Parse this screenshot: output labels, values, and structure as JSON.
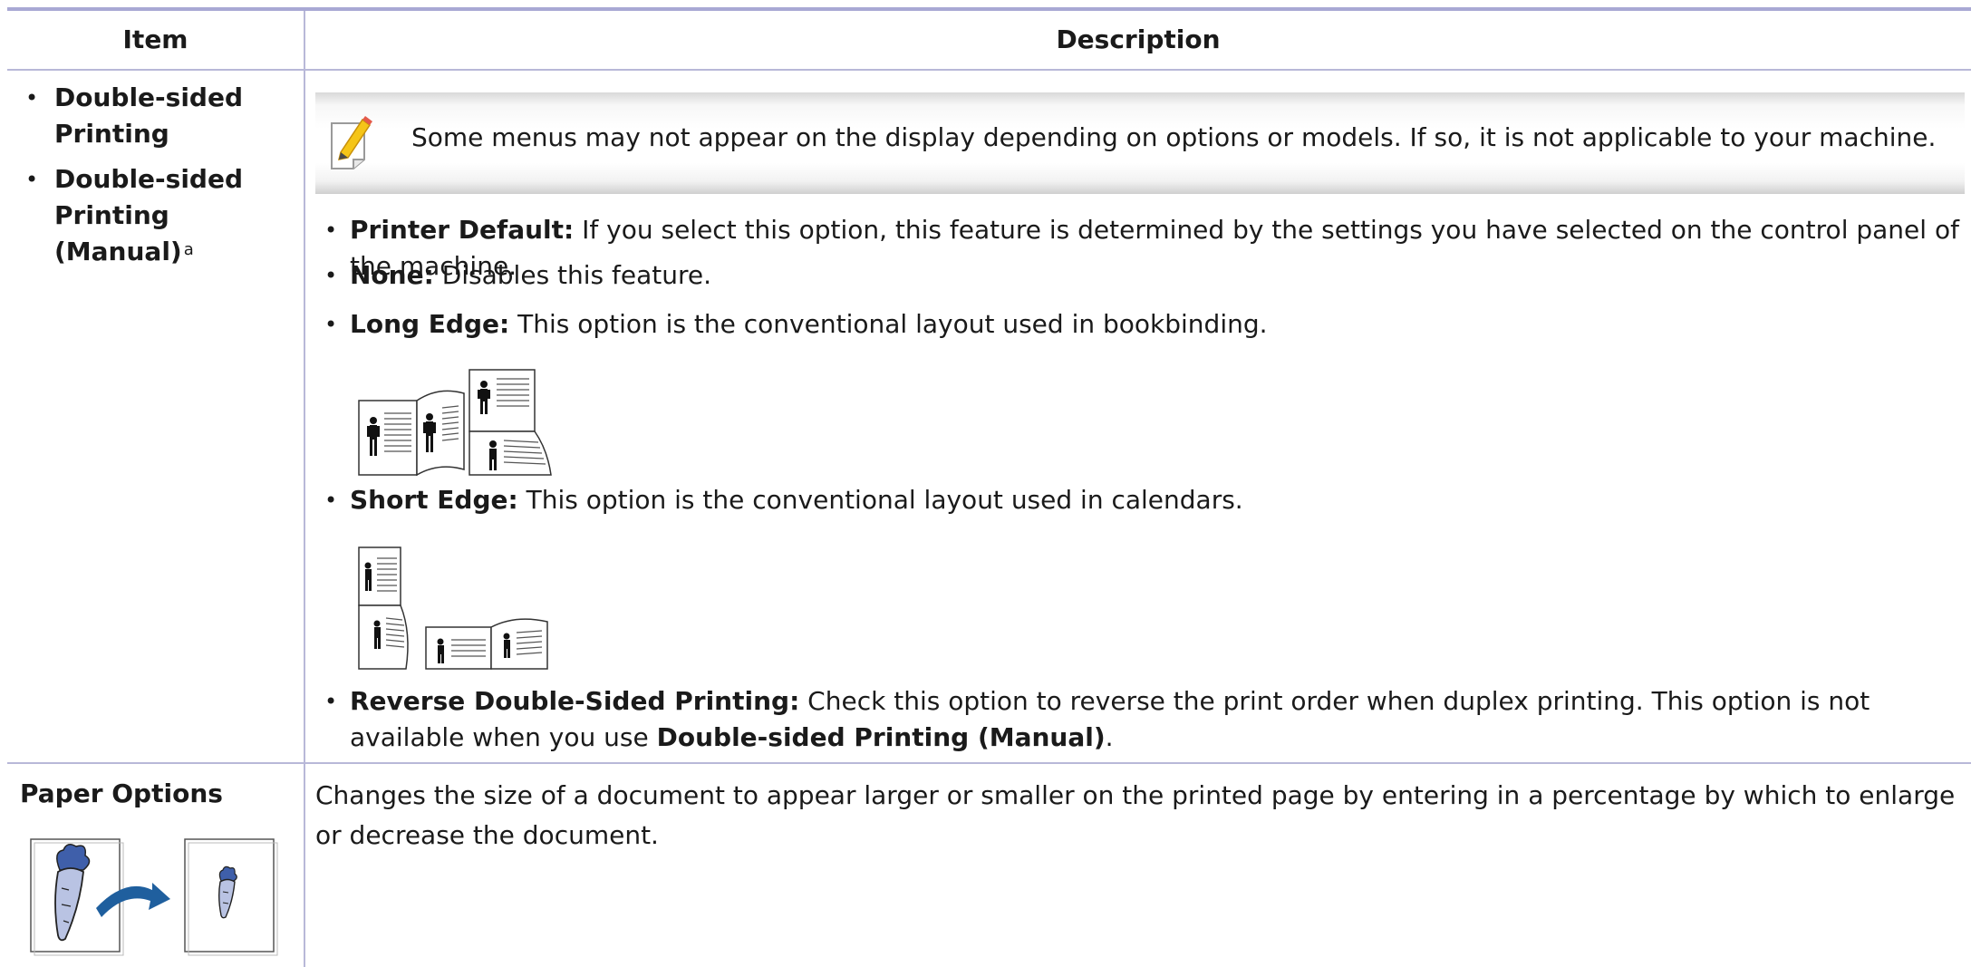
{
  "header": {
    "item": "Item",
    "description": "Description"
  },
  "row1": {
    "items": [
      {
        "label": "Double-sided Printing",
        "sup": ""
      },
      {
        "label": "Double-sided Printing (Manual)",
        "sup": "a"
      }
    ],
    "note": {
      "icon": "note-pencil-icon",
      "text": "Some menus may not appear on the display depending on options or models. If so, it is not applicable to your machine."
    },
    "options": [
      {
        "term": "Printer Default:",
        "text": " If you select this option, this feature is determined by the settings you have selected on the control panel of the machine."
      },
      {
        "term": "None:",
        "text": " Disables this feature."
      },
      {
        "term": "Long Edge:",
        "text": " This option is the conventional layout used in bookbinding."
      },
      {
        "term": "Short Edge:",
        "text": " This option is the conventional layout used in calendars."
      },
      {
        "term": "Reverse Double-Sided Printing:",
        "text": " Check this option to reverse the print order when duplex printing. This option is not available when you use ",
        "term2": "Double-sided Printing (Manual)",
        "tail": "."
      }
    ],
    "illustrations": {
      "long_edge": "long-edge-booklet-illustration",
      "short_edge": "short-edge-calendar-illustration"
    }
  },
  "row2": {
    "title": "Paper Options",
    "description": "Changes the size of a document to appear larger or smaller on the printed page by entering in a percentage by which to enlarge or decrease the document.",
    "illustration": "scale-down-document-illustration"
  },
  "colors": {
    "rule": "#b8b8d8",
    "top_rule": "#a8a8d4",
    "arrow": "#1f5f9e",
    "carrot": "#b9c3e3"
  }
}
